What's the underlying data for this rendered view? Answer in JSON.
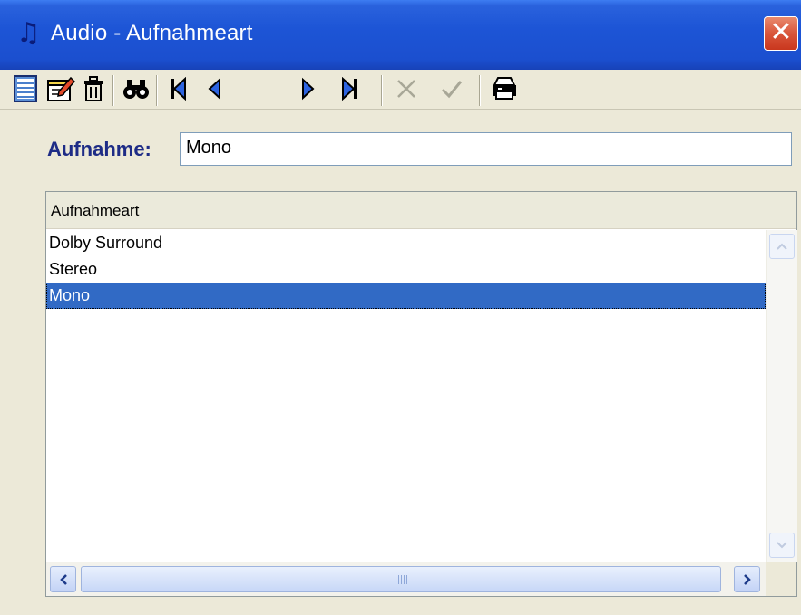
{
  "window": {
    "title": "Audio - Aufnahmeart",
    "icon": "music-note-icon",
    "close_glyph": "✕"
  },
  "toolbar": {
    "buttons": [
      {
        "name": "new-record-button",
        "icon": "notepad-icon"
      },
      {
        "name": "edit-record-button",
        "icon": "edit-pencil-icon"
      },
      {
        "name": "delete-record-button",
        "icon": "trash-icon"
      },
      {
        "name": "search-button",
        "icon": "binoculars-icon"
      },
      {
        "name": "first-record-button",
        "icon": "first-icon"
      },
      {
        "name": "previous-record-button",
        "icon": "previous-icon"
      },
      {
        "name": "next-record-button",
        "icon": "next-icon"
      },
      {
        "name": "last-record-button",
        "icon": "last-icon"
      },
      {
        "name": "cancel-button",
        "icon": "x-icon",
        "disabled": true
      },
      {
        "name": "confirm-button",
        "icon": "check-icon",
        "disabled": true
      },
      {
        "name": "print-button",
        "icon": "printer-icon"
      }
    ]
  },
  "form": {
    "label": "Aufnahme:",
    "value": "Mono"
  },
  "list": {
    "header": "Aufnahmeart",
    "rows": [
      {
        "label": "Dolby Surround",
        "selected": false
      },
      {
        "label": "Stereo",
        "selected": false
      },
      {
        "label": "Mono",
        "selected": true
      }
    ]
  },
  "colors": {
    "title_bar": "#1b4fcf",
    "selection": "#316ac5",
    "label_text": "#1e2c86",
    "window_bg": "#ece9d8"
  }
}
